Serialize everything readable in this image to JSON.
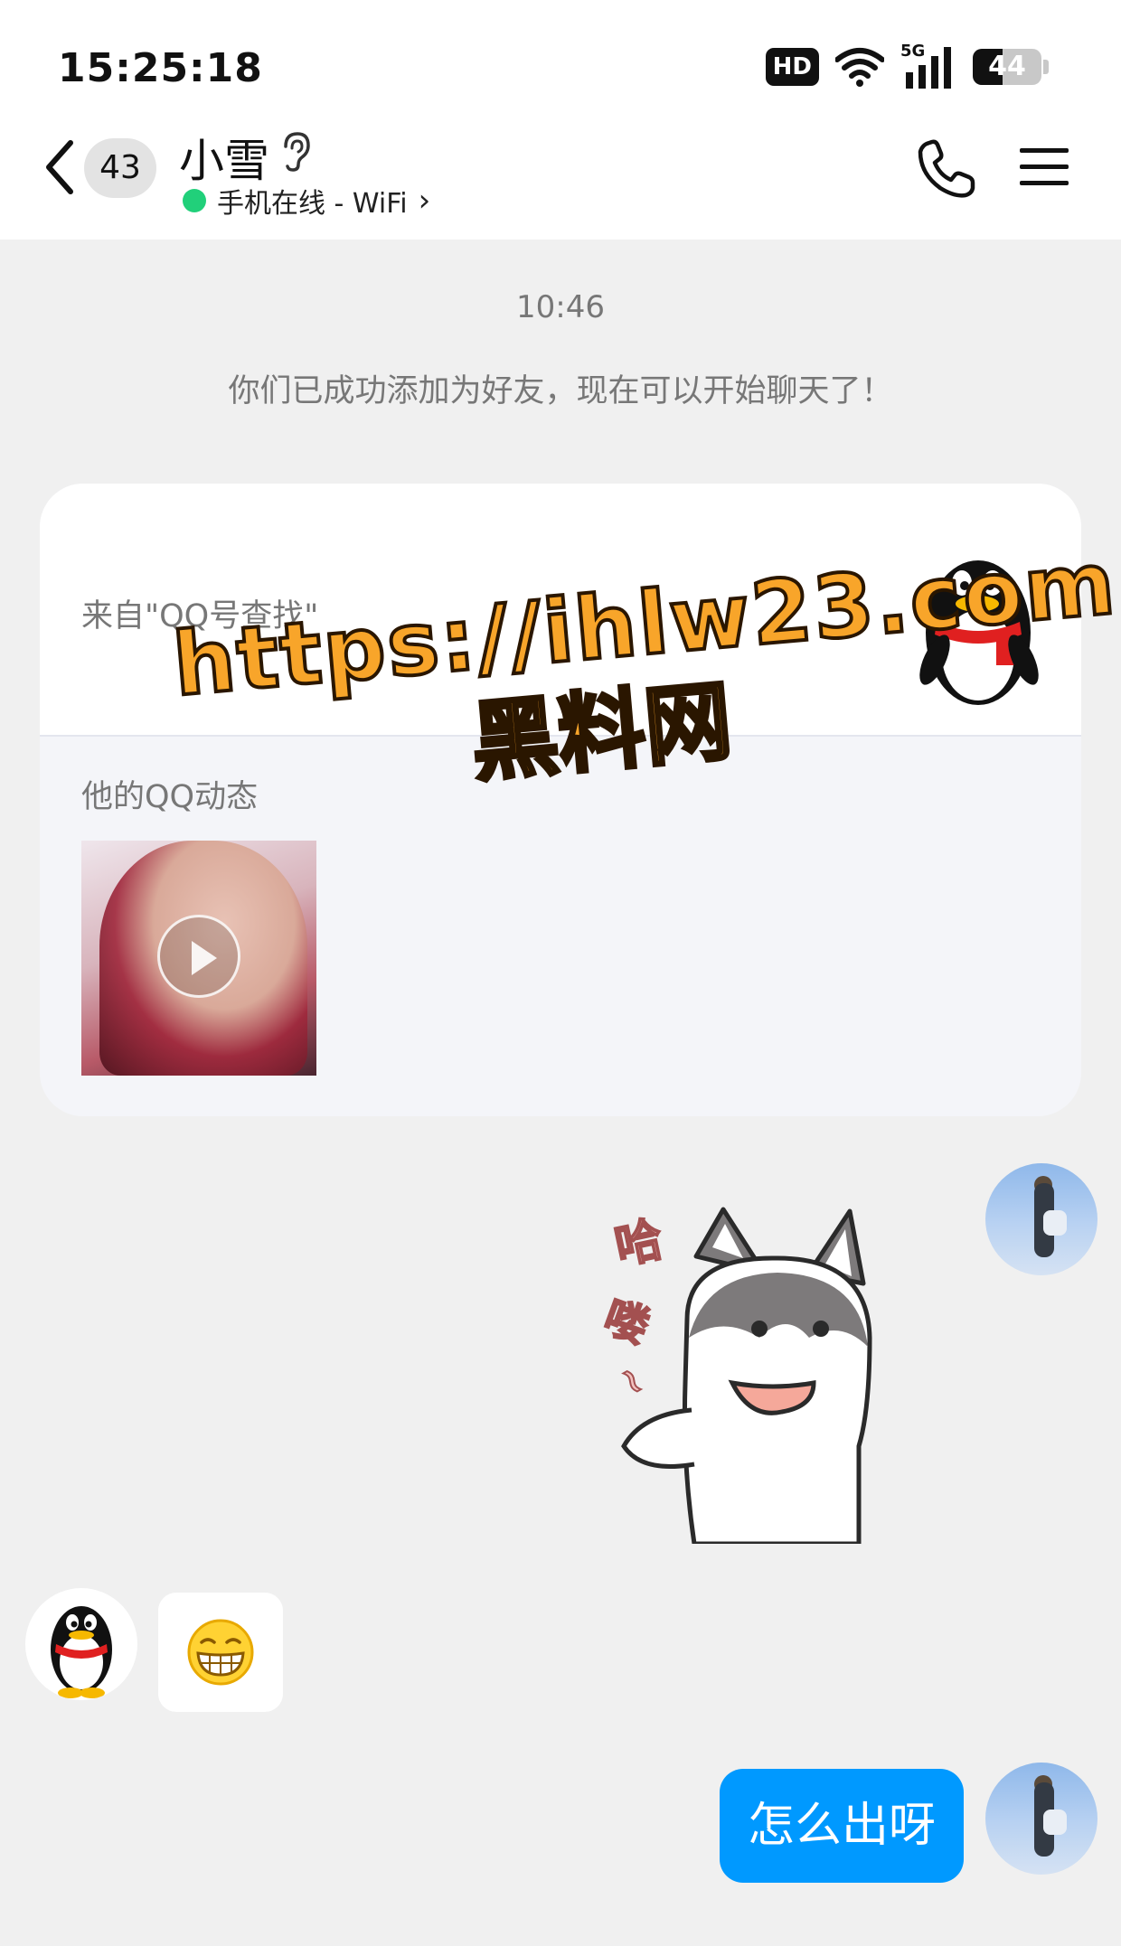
{
  "status_bar": {
    "time": "15:25:18",
    "hd_label": "HD",
    "network_label": "5G",
    "battery_level": "44",
    "battery_fraction": 0.44
  },
  "header": {
    "unread_count": "43",
    "contact_name": "小雪",
    "presence_text": "手机在线 - WiFi",
    "presence_chevron": "›",
    "presence_color": "#21d07a",
    "icons": [
      "back-chevron-icon",
      "ear-icon",
      "phone-icon",
      "menu-icon"
    ]
  },
  "conversation": {
    "timestamp": "10:46",
    "system_message": "你们已成功添加为好友，现在可以开始聊天了！",
    "friend_card": {
      "source_text": "来自\"QQ号查找\"",
      "video_label": "他的QQ动态"
    },
    "watermark": {
      "url": "https://ihlw23.com",
      "name": "黑料网"
    },
    "messages": [
      {
        "from": "me",
        "type": "sticker",
        "sticker_text": "哈喽~"
      },
      {
        "from": "friend",
        "type": "emoji",
        "emoji": "grinning-face-emoji"
      },
      {
        "from": "me",
        "type": "text",
        "text": "怎么出呀"
      }
    ]
  },
  "colors": {
    "accent_blue": "#0099ff",
    "background": "#f0f0f0",
    "watermark_orange": "#f8a52a"
  }
}
